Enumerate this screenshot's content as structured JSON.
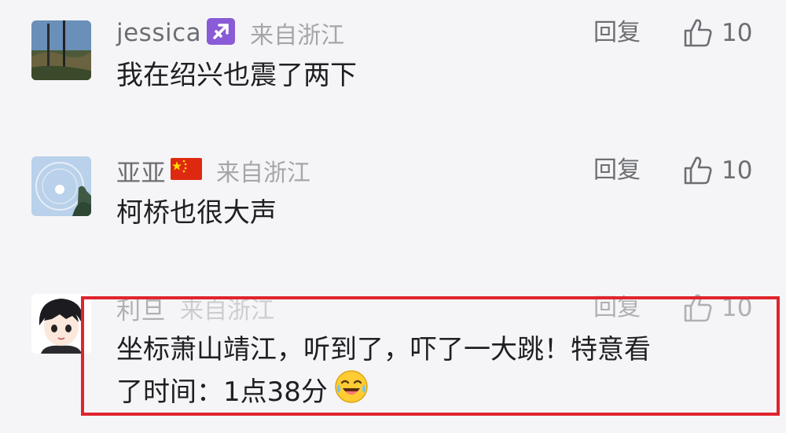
{
  "comments": [
    {
      "username": "jessica",
      "badge_icon": "sagittarius-icon",
      "location": "来自浙江",
      "text": "我在绍兴也震了两下",
      "reply_label": "回复",
      "like_count": "10"
    },
    {
      "username": "亚亚",
      "badge_icon": "china-flag-icon",
      "location": "来自浙江",
      "text": "柯桥也很大声",
      "reply_label": "回复",
      "like_count": "10"
    },
    {
      "username": "利旦",
      "location": "来自浙江",
      "text_line1": "坐标萧山靖江，听到了，吓了一大跳！特意看",
      "text_line2": "了时间：1点38分",
      "emoji": "laughing-crying-emoji",
      "reply_label": "回复",
      "like_count": "10"
    }
  ],
  "highlight_color": "#e0242e",
  "background_color": "#f5f5f7"
}
